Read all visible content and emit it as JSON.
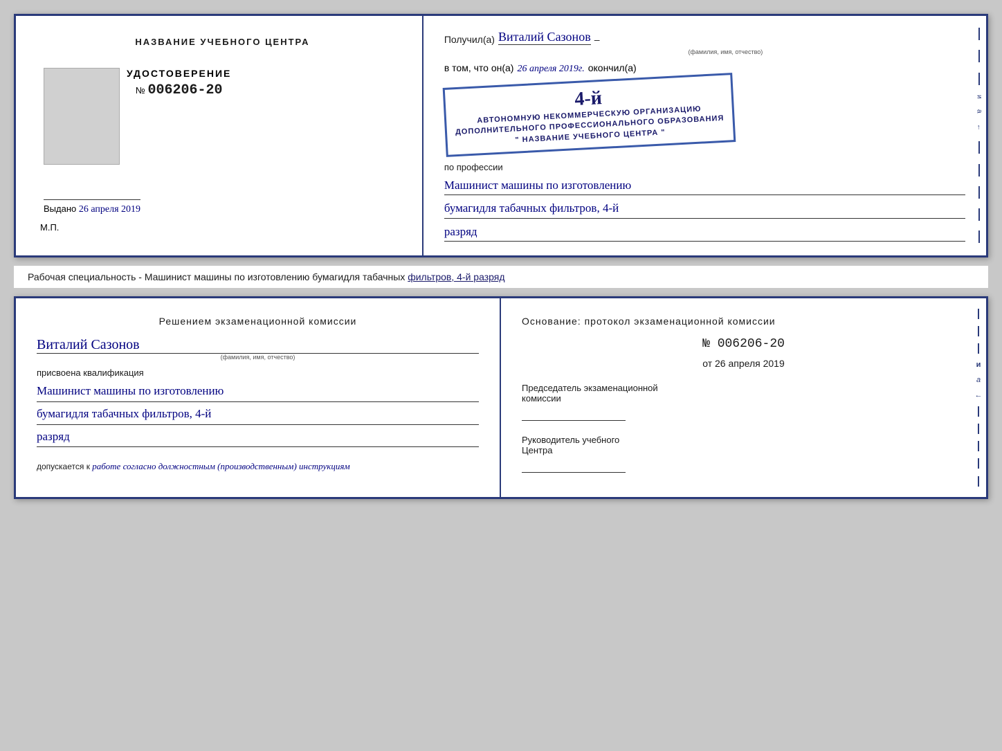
{
  "page": {
    "background_color": "#c8c8c8"
  },
  "top_booklet": {
    "left": {
      "title": "НАЗВАНИЕ УЧЕБНОГО ЦЕНТРА",
      "udostoverenie_label": "УДОСТОВЕРЕНИЕ",
      "number_prefix": "№",
      "number": "006206-20",
      "vydano_label": "Выдано",
      "vydano_date": "26 апреля 2019",
      "mp_label": "М.П."
    },
    "right": {
      "poluchil_label": "Получил(а)",
      "poluchil_name": "Виталий Сазонов",
      "fio_sublabel": "(фамилия, имя, отчество)",
      "dash": "–",
      "vtom_label": "в том, что он(а)",
      "vtom_date": "26 апреля 2019г.",
      "okonchil_label": "окончил(а)",
      "stamp_line1": "АВТОНОМНУЮ НЕКОММЕРЧЕСКУЮ ОРГАНИЗАЦИЮ",
      "stamp_line2": "ДОПОЛНИТЕЛЬНОГО ПРОФЕССИОНАЛЬНОГО ОБРАЗОВАНИЯ",
      "stamp_line3": "\" НАЗВАНИЕ УЧЕБНОГО ЦЕНТРА \"",
      "stamp_number_big": "4-й",
      "po_professii_label": "по профессии",
      "profession_line1": "Машинист машины по изготовлению",
      "profession_line2": "бумагидля табачных фильтров, 4-й",
      "profession_line3": "разряд"
    }
  },
  "middle_strip": {
    "text_prefix": "Рабочая специальность - Машинист машины по изготовлению бумагидля табачных",
    "text_underlined": "фильтров, 4-й разряд"
  },
  "bottom_booklet": {
    "left": {
      "title": "Решением экзаменационной комиссии",
      "name": "Виталий Сазонов",
      "fio_sublabel": "(фамилия, имя, отчество)",
      "prisvoena_label": "присвоена квалификация",
      "qual_line1": "Машинист машины по изготовлению",
      "qual_line2": "бумагидля табачных фильтров, 4-й",
      "qual_line3": "разряд",
      "dopuskaetsya_prefix": "допускается к",
      "dopuskaetsya_text": "работе согласно должностным (производственным) инструкциям"
    },
    "right": {
      "osnovaniye_label": "Основание: протокол экзаменационной комиссии",
      "number_prefix": "№",
      "number": "006206-20",
      "ot_prefix": "от",
      "ot_date": "26 апреля 2019",
      "predsedatel_label": "Председатель экзаменационной",
      "predsedatel_label2": "комиссии",
      "rukovoditel_label": "Руководитель учебного",
      "rukovoditel_label2": "Центра"
    },
    "side_deco": {
      "items": [
        "–",
        "–",
        "–",
        "и",
        "а",
        "←",
        "–",
        "–",
        "–",
        "–",
        "–"
      ]
    }
  }
}
